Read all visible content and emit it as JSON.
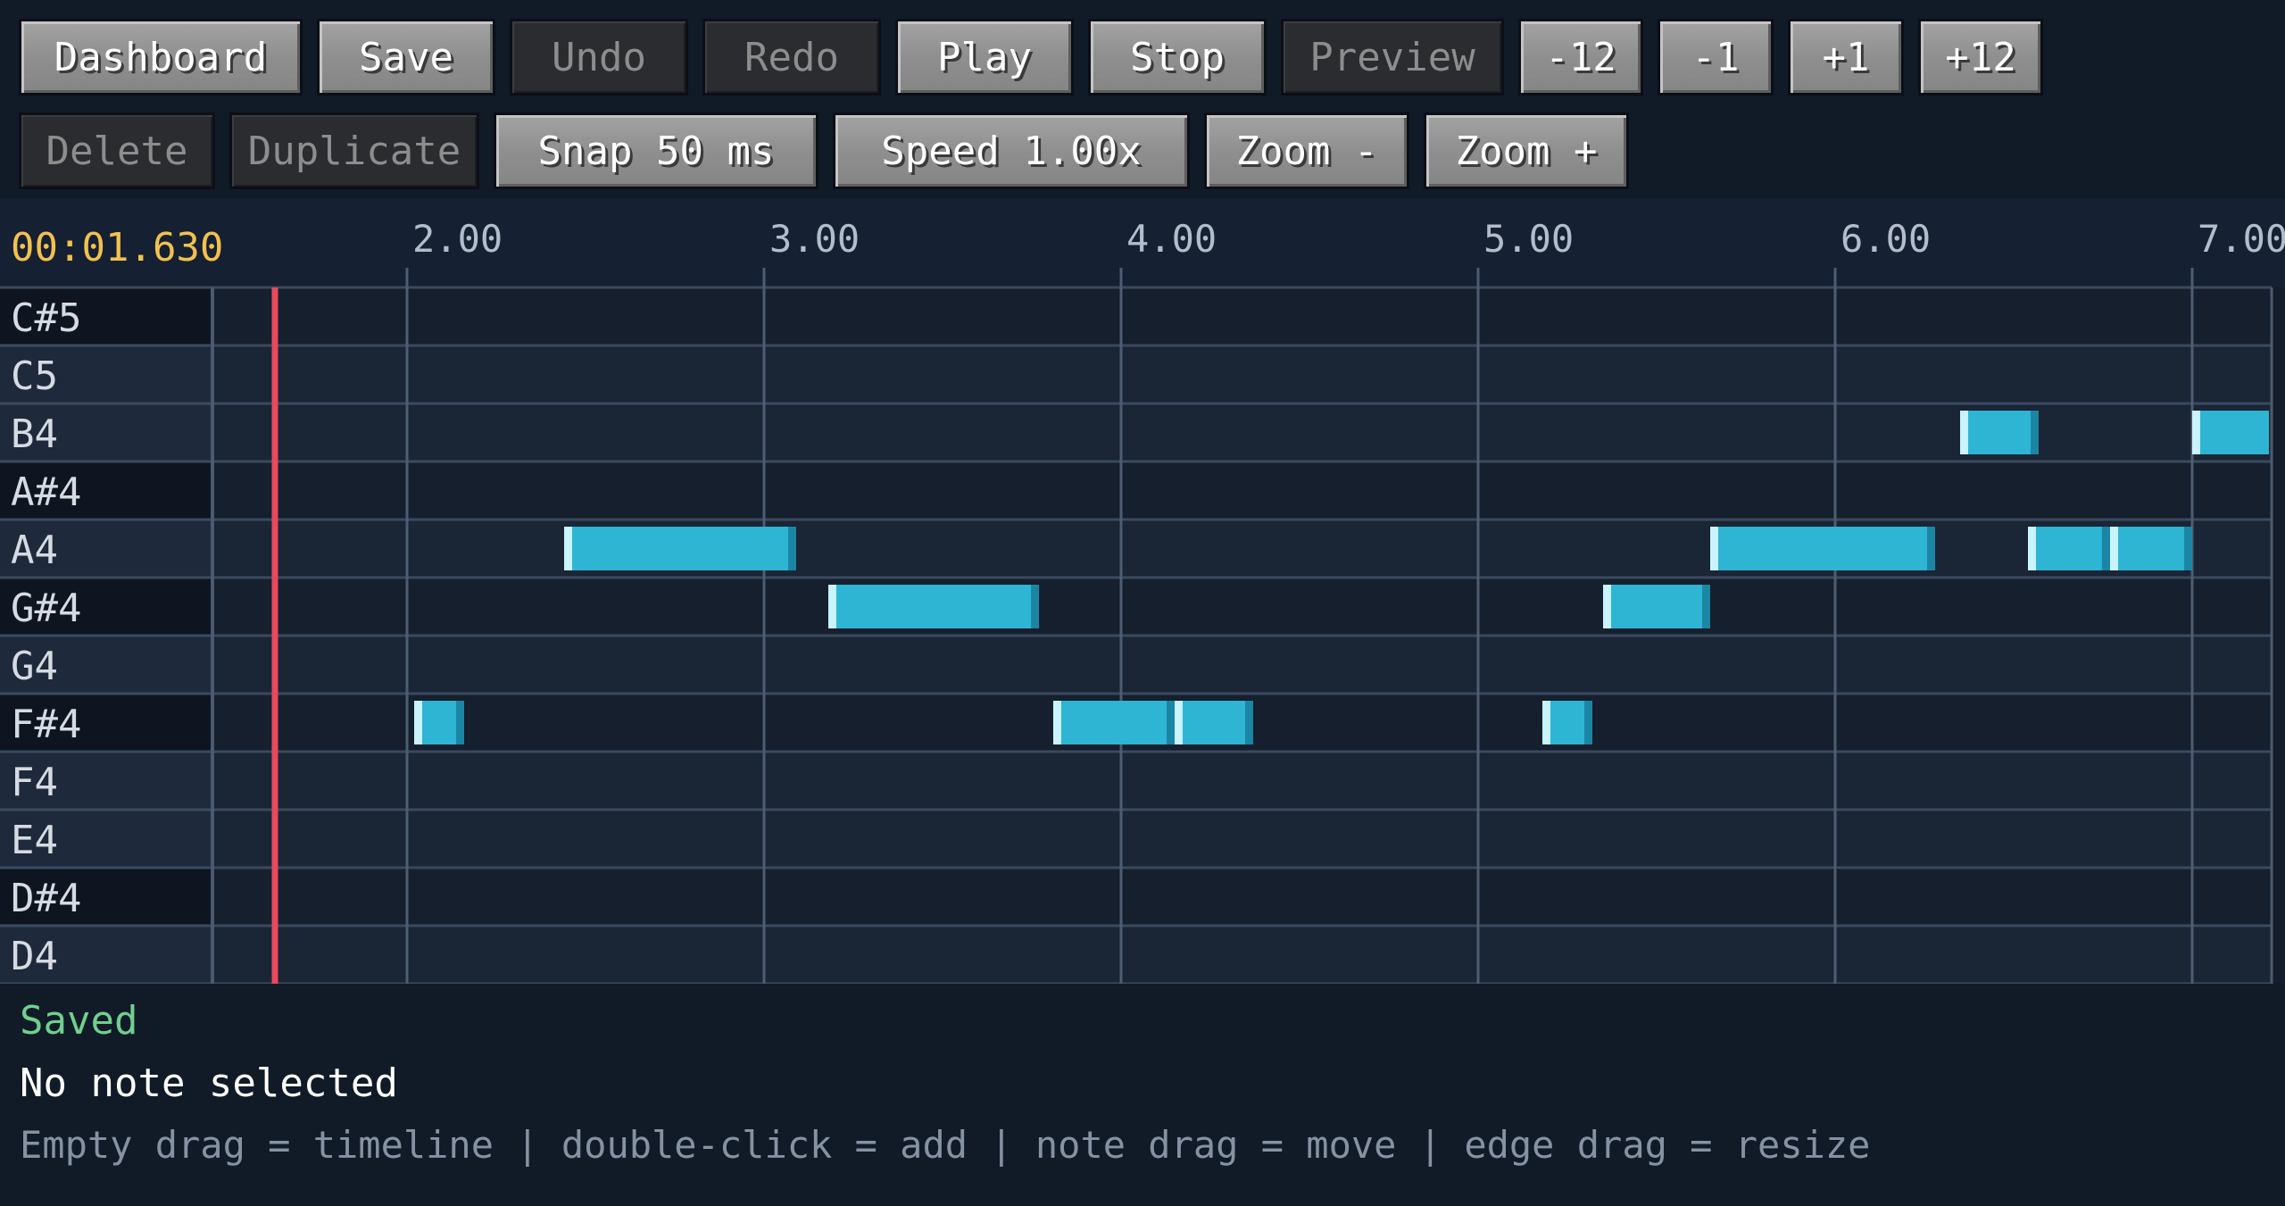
{
  "toolbar": {
    "row1": [
      {
        "name": "dashboard-button",
        "label": "Dashboard",
        "enabled": true
      },
      {
        "name": "save-button",
        "label": "Save",
        "enabled": true
      },
      {
        "name": "undo-button",
        "label": "Undo",
        "enabled": false
      },
      {
        "name": "redo-button",
        "label": "Redo",
        "enabled": false
      },
      {
        "name": "play-button",
        "label": "Play",
        "enabled": true
      },
      {
        "name": "stop-button",
        "label": "Stop",
        "enabled": true
      },
      {
        "name": "preview-button",
        "label": "Preview",
        "enabled": false
      },
      {
        "name": "transpose-minus-12-button",
        "label": "-12",
        "enabled": true
      },
      {
        "name": "transpose-minus-1-button",
        "label": "-1",
        "enabled": true
      },
      {
        "name": "transpose-plus-1-button",
        "label": "+1",
        "enabled": true
      },
      {
        "name": "transpose-plus-12-button",
        "label": "+12",
        "enabled": true
      }
    ],
    "row2": [
      {
        "name": "delete-button",
        "label": "Delete",
        "enabled": false
      },
      {
        "name": "duplicate-button",
        "label": "Duplicate",
        "enabled": false
      },
      {
        "name": "snap-button",
        "label": "Snap 50 ms",
        "enabled": true
      },
      {
        "name": "speed-button",
        "label": "Speed 1.00x",
        "enabled": true
      },
      {
        "name": "zoom-out-button",
        "label": "Zoom -",
        "enabled": true
      },
      {
        "name": "zoom-in-button",
        "label": "Zoom +",
        "enabled": true
      }
    ]
  },
  "timeline": {
    "current_time": "00:01.630",
    "playhead_time": 1.63,
    "tick_labels": [
      "2.00",
      "3.00",
      "4.00",
      "5.00",
      "6.00",
      "7.00"
    ],
    "tick_values": [
      2,
      3,
      4,
      5,
      6,
      7
    ]
  },
  "piano_roll": {
    "pitches": [
      "C#5",
      "C5",
      "B4",
      "A#4",
      "A4",
      "G#4",
      "G4",
      "F#4",
      "F4",
      "E4",
      "D#4",
      "D4"
    ],
    "black_keys": [
      "C#5",
      "A#4",
      "G#4",
      "F#4",
      "D#4"
    ],
    "notes": [
      {
        "pitch": "F#4",
        "start": 2.02,
        "end": 2.16
      },
      {
        "pitch": "A4",
        "start": 2.44,
        "end": 3.09
      },
      {
        "pitch": "G#4",
        "start": 3.18,
        "end": 3.77
      },
      {
        "pitch": "F#4",
        "start": 3.81,
        "end": 4.15
      },
      {
        "pitch": "F#4",
        "start": 4.15,
        "end": 4.37
      },
      {
        "pitch": "F#4",
        "start": 5.18,
        "end": 5.32
      },
      {
        "pitch": "G#4",
        "start": 5.35,
        "end": 5.65
      },
      {
        "pitch": "A4",
        "start": 5.65,
        "end": 6.28
      },
      {
        "pitch": "B4",
        "start": 6.35,
        "end": 6.57
      },
      {
        "pitch": "A4",
        "start": 6.54,
        "end": 6.77
      },
      {
        "pitch": "A4",
        "start": 6.77,
        "end": 7.0
      },
      {
        "pitch": "B4",
        "start": 7.0,
        "end": 7.22
      }
    ]
  },
  "colors": {
    "note_fill": "#2eb5d3",
    "note_head": "#c9f3ff",
    "note_tail": "#1b86a4",
    "playhead": "#e8495d",
    "time_readout": "#f2c14e"
  },
  "status": {
    "saved": "Saved",
    "selection": "No note selected",
    "hint": "Empty drag = timeline | double-click = add | note drag = move | edge drag = resize"
  }
}
